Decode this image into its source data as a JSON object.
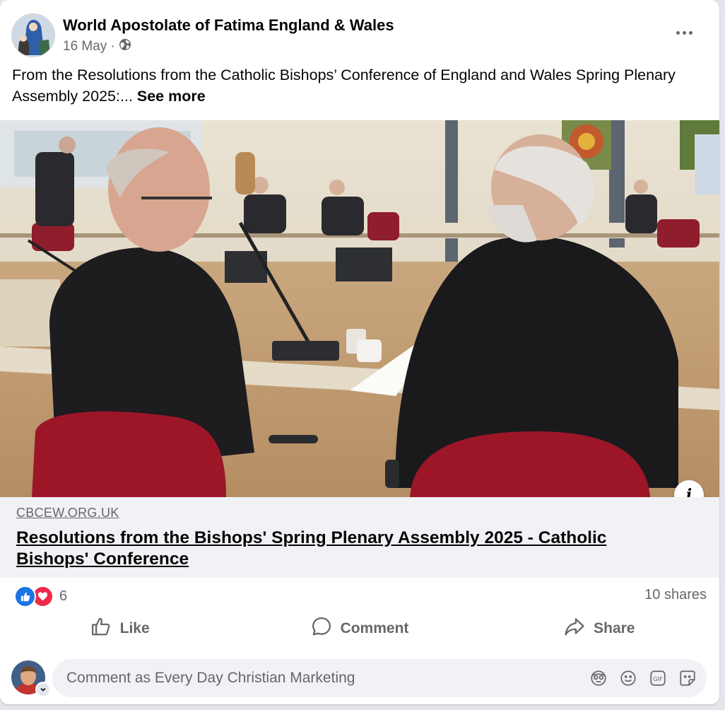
{
  "post": {
    "page_name": "World Apostolate of Fatima England & Wales",
    "date": "16 May",
    "separator": "·",
    "audience_icon": "globe-icon",
    "text": "From the Resolutions from the Catholic Bishops’ Conference of England and Wales Spring Plenary Assembly 2025:...",
    "see_more": "See more"
  },
  "photo": {
    "info_label": "i"
  },
  "link_preview": {
    "domain": "CBCEW.ORG.UK",
    "title": "Resolutions from the Bishops' Spring Plenary Assembly 2025 - Catholic Bishops' Conference"
  },
  "engagement": {
    "reaction_icons": [
      "like-reaction-icon",
      "love-reaction-icon"
    ],
    "reaction_count": "6",
    "shares": "10 shares"
  },
  "actions": {
    "like": "Like",
    "comment": "Comment",
    "share": "Share"
  },
  "comment_composer": {
    "placeholder": "Comment as Every Day Christian Marketing",
    "tools": [
      "avatar-sticker-icon",
      "emoji-icon",
      "gif-icon",
      "sticker-icon"
    ]
  },
  "colors": {
    "brand_blue": "#1b74e4",
    "love_red": "#f02849",
    "secondary_text": "#65676b",
    "link_box_bg": "#f0f2f5"
  }
}
